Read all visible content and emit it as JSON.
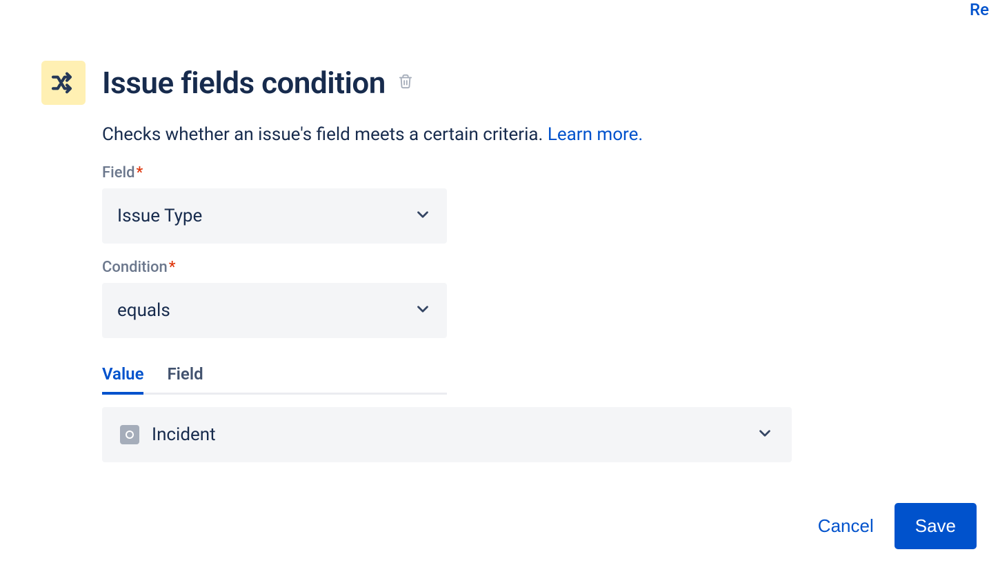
{
  "topRight": "Re",
  "header": {
    "title": "Issue fields condition"
  },
  "description": {
    "text": "Checks whether an issue's field meets a certain criteria. ",
    "linkText": "Learn more."
  },
  "form": {
    "field": {
      "label": "Field",
      "value": "Issue Type"
    },
    "condition": {
      "label": "Condition",
      "value": "equals"
    }
  },
  "tabs": [
    {
      "label": "Value",
      "active": true
    },
    {
      "label": "Field",
      "active": false
    }
  ],
  "valueSelect": {
    "value": "Incident"
  },
  "footer": {
    "cancel": "Cancel",
    "save": "Save"
  }
}
